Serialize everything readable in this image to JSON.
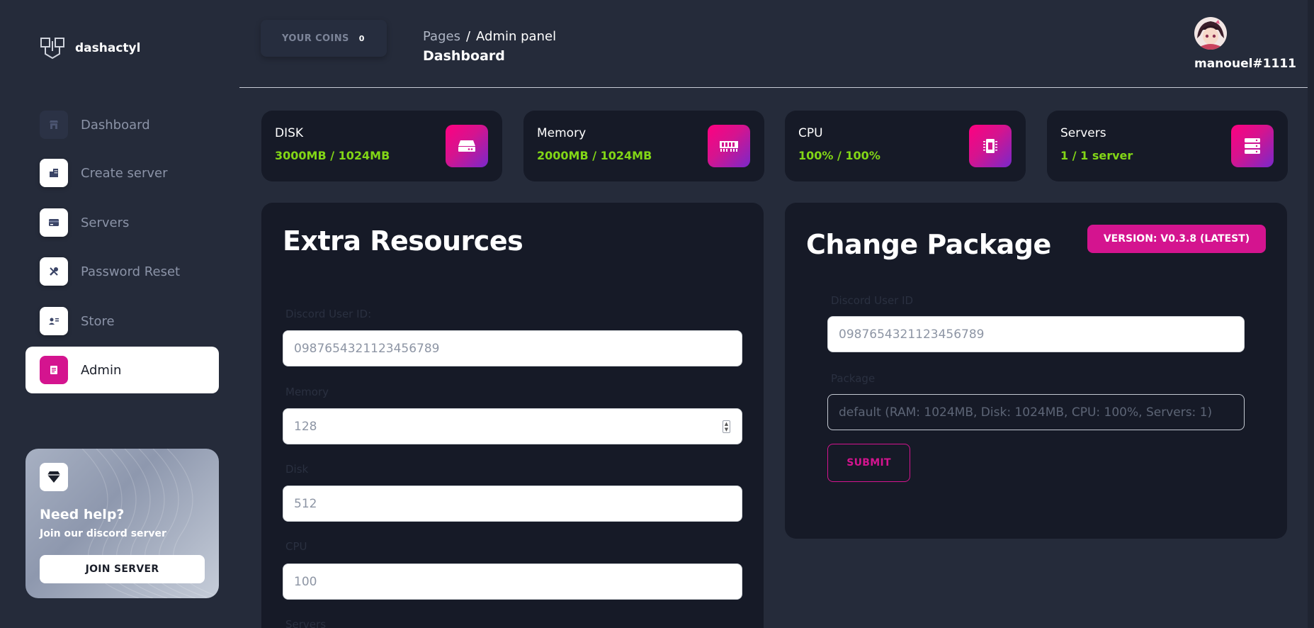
{
  "brand": {
    "name": "dashactyl"
  },
  "sidebar": {
    "items": [
      {
        "label": "Dashboard",
        "icon": "shop-icon"
      },
      {
        "label": "Create server",
        "icon": "office-icon"
      },
      {
        "label": "Servers",
        "icon": "credit-card-icon"
      },
      {
        "label": "Password Reset",
        "icon": "settings-tools-icon"
      },
      {
        "label": "Store",
        "icon": "user-card-icon"
      },
      {
        "label": "Admin",
        "icon": "document-icon",
        "active": true
      }
    ],
    "help": {
      "title": "Need help?",
      "subtitle": "Join our discord server",
      "button": "JOIN SERVER",
      "icon": "diamond-icon"
    }
  },
  "header": {
    "coins_label": "YOUR COINS",
    "coins_value": "0",
    "breadcrumb_parent": "Pages",
    "breadcrumb_separator": "/",
    "breadcrumb_current": "Admin panel",
    "page_title": "Dashboard",
    "username": "manouel#1111"
  },
  "stats": [
    {
      "title": "DISK",
      "value": "3000MB / 1024MB",
      "icon": "hard-drive-icon"
    },
    {
      "title": "Memory",
      "value": "2000MB / 1024MB",
      "icon": "memory-icon"
    },
    {
      "title": "CPU",
      "value": "100% / 100%",
      "icon": "cpu-icon"
    },
    {
      "title": "Servers",
      "value": "1 / 1 server",
      "icon": "server-stack-icon"
    }
  ],
  "extra_resources": {
    "title": "Extra Resources",
    "fields": [
      {
        "label": "Discord User ID:",
        "placeholder": "0987654321123456789"
      },
      {
        "label": "Memory",
        "placeholder": "128"
      },
      {
        "label": "Disk",
        "placeholder": "512"
      },
      {
        "label": "CPU",
        "placeholder": "100"
      },
      {
        "label": "Servers",
        "placeholder": ""
      }
    ]
  },
  "change_package": {
    "title": "Change Package",
    "version": "VERSION: V0.3.8 (LATEST)",
    "fields": [
      {
        "label": "Discord User ID",
        "placeholder": "0987654321123456789"
      },
      {
        "label": "Package",
        "value": "default (RAM: 1024MB, Disk: 1024MB, CPU: 100%, Servers: 1)"
      }
    ],
    "submit": "SUBMIT"
  },
  "colors": {
    "accent": "#d4148f",
    "success": "#82d616",
    "card_bg": "#161a27",
    "page_bg": "#252b3a"
  }
}
